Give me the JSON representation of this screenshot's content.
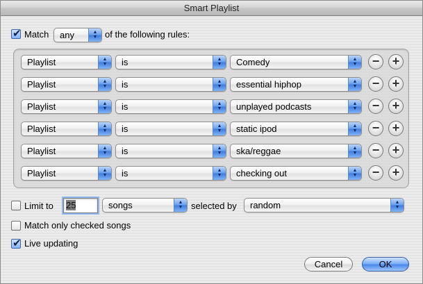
{
  "window": {
    "title": "Smart Playlist"
  },
  "match": {
    "checked": true,
    "label": "Match",
    "mode": "any",
    "suffix": "of the following rules:"
  },
  "rules": [
    {
      "field": "Playlist",
      "operator": "is",
      "value": "Comedy"
    },
    {
      "field": "Playlist",
      "operator": "is",
      "value": "essential hiphop"
    },
    {
      "field": "Playlist",
      "operator": "is",
      "value": "unplayed podcasts"
    },
    {
      "field": "Playlist",
      "operator": "is",
      "value": "static ipod"
    },
    {
      "field": "Playlist",
      "operator": "is",
      "value": "ska/reggae"
    },
    {
      "field": "Playlist",
      "operator": "is",
      "value": "checking out"
    }
  ],
  "rule_buttons": {
    "remove": "−",
    "add": "+"
  },
  "limit": {
    "checked": false,
    "label": "Limit to",
    "count": "25",
    "unit": "songs",
    "selected_by_label": "selected by",
    "selected_by": "random"
  },
  "options": {
    "checked_only": {
      "checked": false,
      "label": "Match only checked songs"
    },
    "live_updating": {
      "checked": true,
      "label": "Live updating"
    }
  },
  "buttons": {
    "cancel": "Cancel",
    "ok": "OK"
  },
  "icons": {
    "checkmark": "✔",
    "popup_arrows": "▲▼"
  },
  "colors": {
    "accent": "#4a89ea",
    "title_bar": "#c6c6c6"
  }
}
